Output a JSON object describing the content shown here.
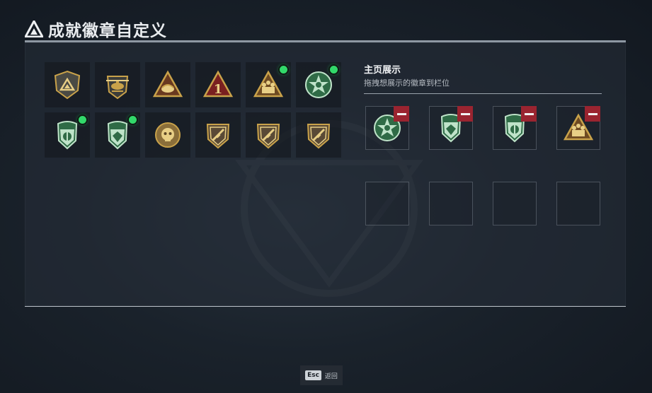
{
  "header": {
    "title": "成就徽章自定义",
    "logo_icon": "triangle-emblem-icon"
  },
  "badges": [
    {
      "icon": "shield-triangle-badge-icon",
      "equipped": false
    },
    {
      "icon": "helicopter-badge-icon",
      "equipped": false
    },
    {
      "icon": "triangle-wing-badge-icon",
      "equipped": false
    },
    {
      "icon": "triangle-number-badge-icon",
      "number_text": "1",
      "equipped": false
    },
    {
      "icon": "triangle-soldiers-badge-icon",
      "equipped": true
    },
    {
      "icon": "green-star-badge-icon",
      "equipped": true
    },
    {
      "icon": "green-shield-emblem-badge-icon",
      "equipped": true
    },
    {
      "icon": "green-shield-gem-badge-icon",
      "equipped": true
    },
    {
      "icon": "round-skull-badge-icon",
      "equipped": false
    },
    {
      "icon": "shield-rifle-badge-icon",
      "equipped": false
    },
    {
      "icon": "shield-rifle-badge-icon",
      "equipped": false
    },
    {
      "icon": "shield-rifle-badge-icon",
      "equipped": false
    }
  ],
  "showcase": {
    "title": "主页展示",
    "subtitle": "拖拽想展示的徽章到栏位",
    "slots": [
      {
        "badge": "green-star-badge-icon"
      },
      {
        "badge": "green-shield-gem-badge-icon"
      },
      {
        "badge": "green-shield-emblem-badge-icon"
      },
      {
        "badge": "triangle-soldiers-badge-icon"
      },
      {
        "badge": null
      },
      {
        "badge": null
      },
      {
        "badge": null
      },
      {
        "badge": null
      }
    ]
  },
  "footer": {
    "key_label": "Esc",
    "back_label": "返回"
  },
  "colors": {
    "equipped_dot": "#32d96a",
    "remove_button": "#9a2430",
    "panel_border": "#8e98a3"
  }
}
